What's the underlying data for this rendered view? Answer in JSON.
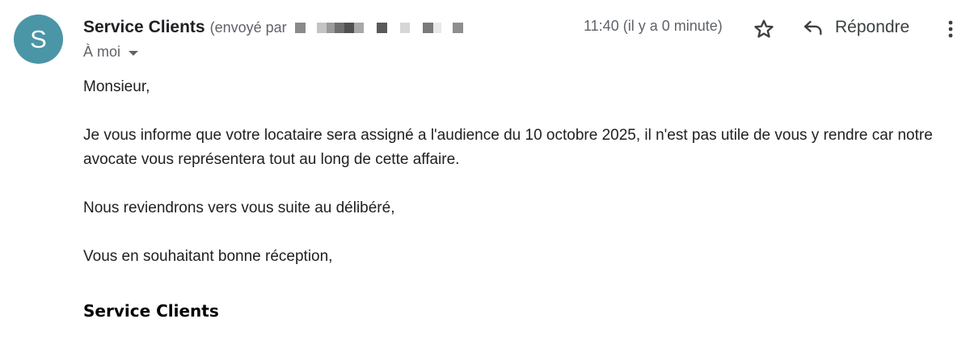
{
  "header": {
    "avatar_letter": "S",
    "sender_name": "Service Clients",
    "sent_by_prefix": "(envoyé par",
    "recipient_label": "À moi",
    "timestamp": "11:40 (il y a 0 minute)",
    "reply_label": "Répondre"
  },
  "icons": {
    "star": "star-outline-icon",
    "reply": "reply-arrow-icon",
    "more": "more-vertical-icon",
    "caret": "caret-down-icon"
  },
  "colors": {
    "avatar_bg": "#4a96a6",
    "secondary_text": "#5f6368"
  },
  "body": {
    "greeting": "Monsieur,",
    "main": "Je vous informe que votre locataire sera assigné a l'audience du 10 octobre 2025, il n'est pas utile de vous y rendre car notre avocate vous représentera tout au long de cette affaire.",
    "follow_up": "Nous reviendrons vers vous suite au délibéré,",
    "closing": "Vous en souhaitant bonne réception,",
    "signature": "Service Clients"
  }
}
